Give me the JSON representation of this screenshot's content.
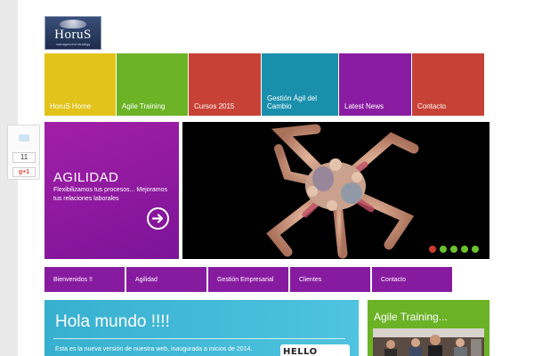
{
  "logo": {
    "brand": "HoruS",
    "tagline": "management strategy"
  },
  "tiles": [
    {
      "label": "HoruS Home",
      "color": "#e2c31a"
    },
    {
      "label": "Agile Training",
      "color": "#6cb326"
    },
    {
      "label": "Cursos 2015",
      "color": "#c74136"
    },
    {
      "label": "Gestión Ágil del Cambio",
      "color": "#1a8fac"
    },
    {
      "label": "Latest News",
      "color": "#8a1ca2"
    },
    {
      "label": "Contacto",
      "color": "#c74136"
    }
  ],
  "share": {
    "count": "11",
    "gplus": "g+1"
  },
  "hero": {
    "title": "AGILIDAD",
    "text": "Flexibilizamos tus procesos... Mejoramos tus relaciones laborales"
  },
  "slider": {
    "dots": [
      {
        "color": "#cc3a2f",
        "active": true
      },
      {
        "color": "#6cc22c",
        "active": false
      },
      {
        "color": "#6cc22c",
        "active": false
      },
      {
        "color": "#6cc22c",
        "active": false
      },
      {
        "color": "#6cc22c",
        "active": false
      }
    ]
  },
  "subnav": [
    {
      "label": "Bienvenidos !!"
    },
    {
      "label": "Agilidad"
    },
    {
      "label": "Gestión Empresarial"
    },
    {
      "label": "Clientes"
    },
    {
      "label": "Contacto"
    }
  ],
  "hello": {
    "title": "Hola mundo !!!!",
    "text": "Esta es la nueva versión de nuestra web, inaugurada a inicios de 2014.",
    "image_text": "HELLO WORLD"
  },
  "agile": {
    "title": "Agile Training..."
  },
  "colors": {
    "purple": "#8a1ca2",
    "subnav": "#871ba0"
  }
}
